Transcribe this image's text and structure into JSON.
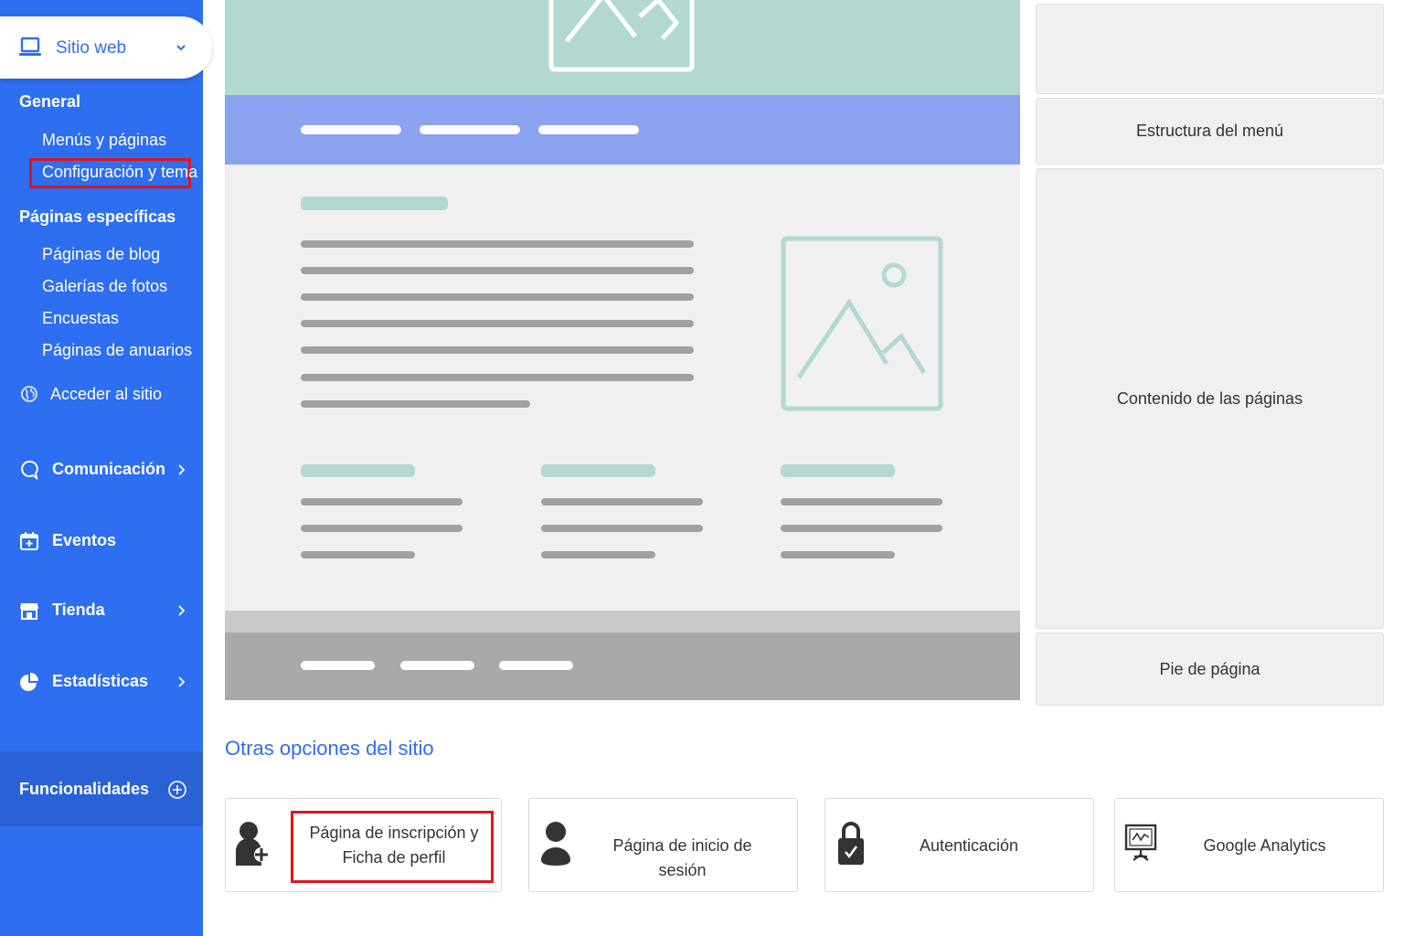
{
  "sidebar": {
    "site_selector": "Sitio web",
    "general_heading": "General",
    "general_items": [
      "Menús y páginas",
      "Configuración y tema"
    ],
    "specific_heading": "Páginas específicas",
    "specific_items": [
      "Páginas de blog",
      "Galerías de fotos",
      "Encuestas",
      "Páginas de anuarios"
    ],
    "access_site": "Acceder al sitio",
    "nav": {
      "communication": "Comunicación",
      "events": "Eventos",
      "shop": "Tienda",
      "stats": "Estadísticas"
    },
    "features": "Funcionalidades"
  },
  "structure": {
    "menu": "Estructura del menú",
    "content": "Contenido de las páginas",
    "footer": "Pie de página"
  },
  "other": {
    "title": "Otras opciones del sitio",
    "signup_profile": "Página de inscripción y Ficha de perfil",
    "login_page": "Página de inicio de sesión",
    "auth": "Autenticación",
    "analytics": "Google Analytics"
  },
  "colors": {
    "sidebar_blue": "#2e6ef0",
    "highlight_red": "#e0141e",
    "mock_teal": "#b2d8d1",
    "mock_nav": "#8ba2ee"
  }
}
